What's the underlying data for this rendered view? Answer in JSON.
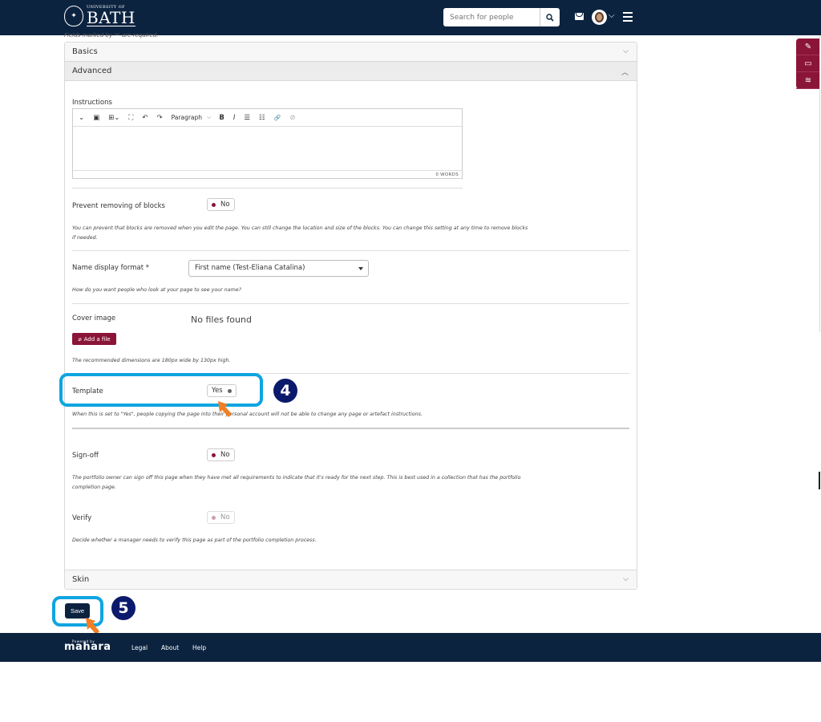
{
  "header": {
    "logo_small": "UNIVERSITY OF",
    "logo_big": "BATH",
    "search_placeholder": "Search for people",
    "avatar_chevron": "⌵"
  },
  "side_tools": [
    "✎",
    "▭",
    "≋"
  ],
  "required_note": "Fields marked by '*' are required.",
  "panels": {
    "basics": "Basics",
    "advanced": "Advanced",
    "skin": "Skin"
  },
  "instructions": {
    "label": "Instructions",
    "toolbar": [
      "⌄",
      "▣",
      "⊞⌄",
      "⛶",
      "↶",
      "↷"
    ],
    "paragraph": "Paragraph",
    "format_buttons": [
      "B",
      "I",
      "☰",
      "☷",
      "🔗",
      "⊘"
    ],
    "word_count": "0 WORDS"
  },
  "prevent_removing": {
    "label": "Prevent removing of blocks",
    "value": "No",
    "desc": "You can prevent that blocks are removed when you edit the page. You can still change the location and size of the blocks. You can change this setting at any time to remove blocks if needed."
  },
  "name_display": {
    "label": "Name display format *",
    "value": "First name (Test-Eliana Catalina)",
    "desc": "How do you want people who look at your page to see your name?"
  },
  "cover_image": {
    "label": "Cover image",
    "no_files": "No files found",
    "add_button": "Add a file",
    "desc": "The recommended dimensions are 180px wide by 130px high."
  },
  "template": {
    "label": "Template",
    "value": "Yes",
    "desc": "When this is set to \"Yes\", people copying the page into their personal account will not be able to change any page or artefact instructions."
  },
  "sign_off": {
    "label": "Sign-off",
    "value": "No",
    "desc": "The portfolio owner can sign off this page when they have met all requirements to indicate that it's ready for the next step. This is best used in a collection that has the portfolio completion page."
  },
  "verify": {
    "label": "Verify",
    "value": "No",
    "desc": "Decide whether a manager needs to verify this page as part of the portfolio completion process."
  },
  "save_label": "Save",
  "steps": [
    "4",
    "5"
  ],
  "footer": {
    "brand": "mahara",
    "powered": "Powered by",
    "links": [
      "Legal",
      "About",
      "Help"
    ]
  },
  "colors": {
    "header_bg": "#0c2340",
    "accent": "#8a1538",
    "callout": "#0ea5e0",
    "step_badge": "#0c1a6b",
    "pointer": "#f07f25"
  }
}
